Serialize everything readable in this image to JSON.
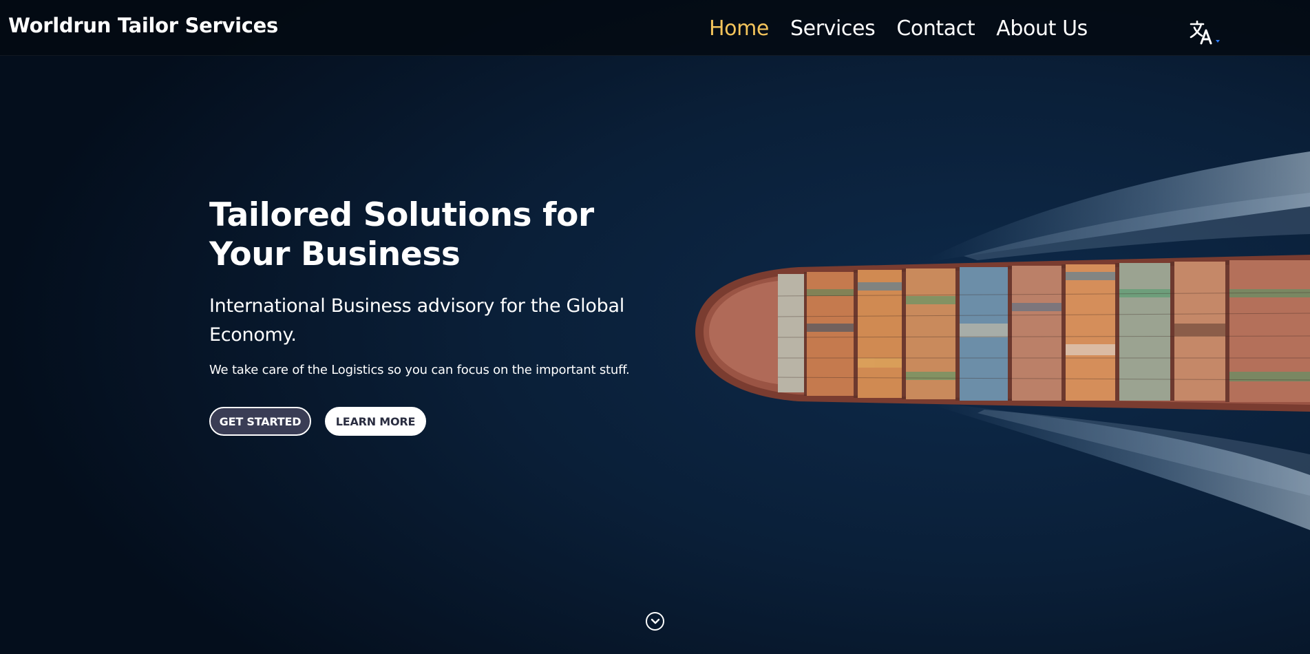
{
  "header": {
    "brand": "Worldrun Tailor Services",
    "nav": [
      {
        "label": "Home",
        "active": true
      },
      {
        "label": "Services",
        "active": false
      },
      {
        "label": "Contact",
        "active": false
      },
      {
        "label": "About Us",
        "active": false
      }
    ],
    "language_icon": "translate-icon"
  },
  "hero": {
    "title": "Tailored Solutions for Your Business",
    "subtitle": "International Business advisory for the Global Economy.",
    "text": "We take care of the Logistics so you can focus on the important stuff.",
    "primary_button": "GET STARTED",
    "secondary_button": "LEARN MORE",
    "background_image": "container-ship-aerial"
  },
  "scroll_icon": "chevron-down-circle-icon",
  "colors": {
    "accent": "#f3c45b",
    "background": "#06162a",
    "primary_button": "#3a3d55",
    "header": "#030a12"
  }
}
